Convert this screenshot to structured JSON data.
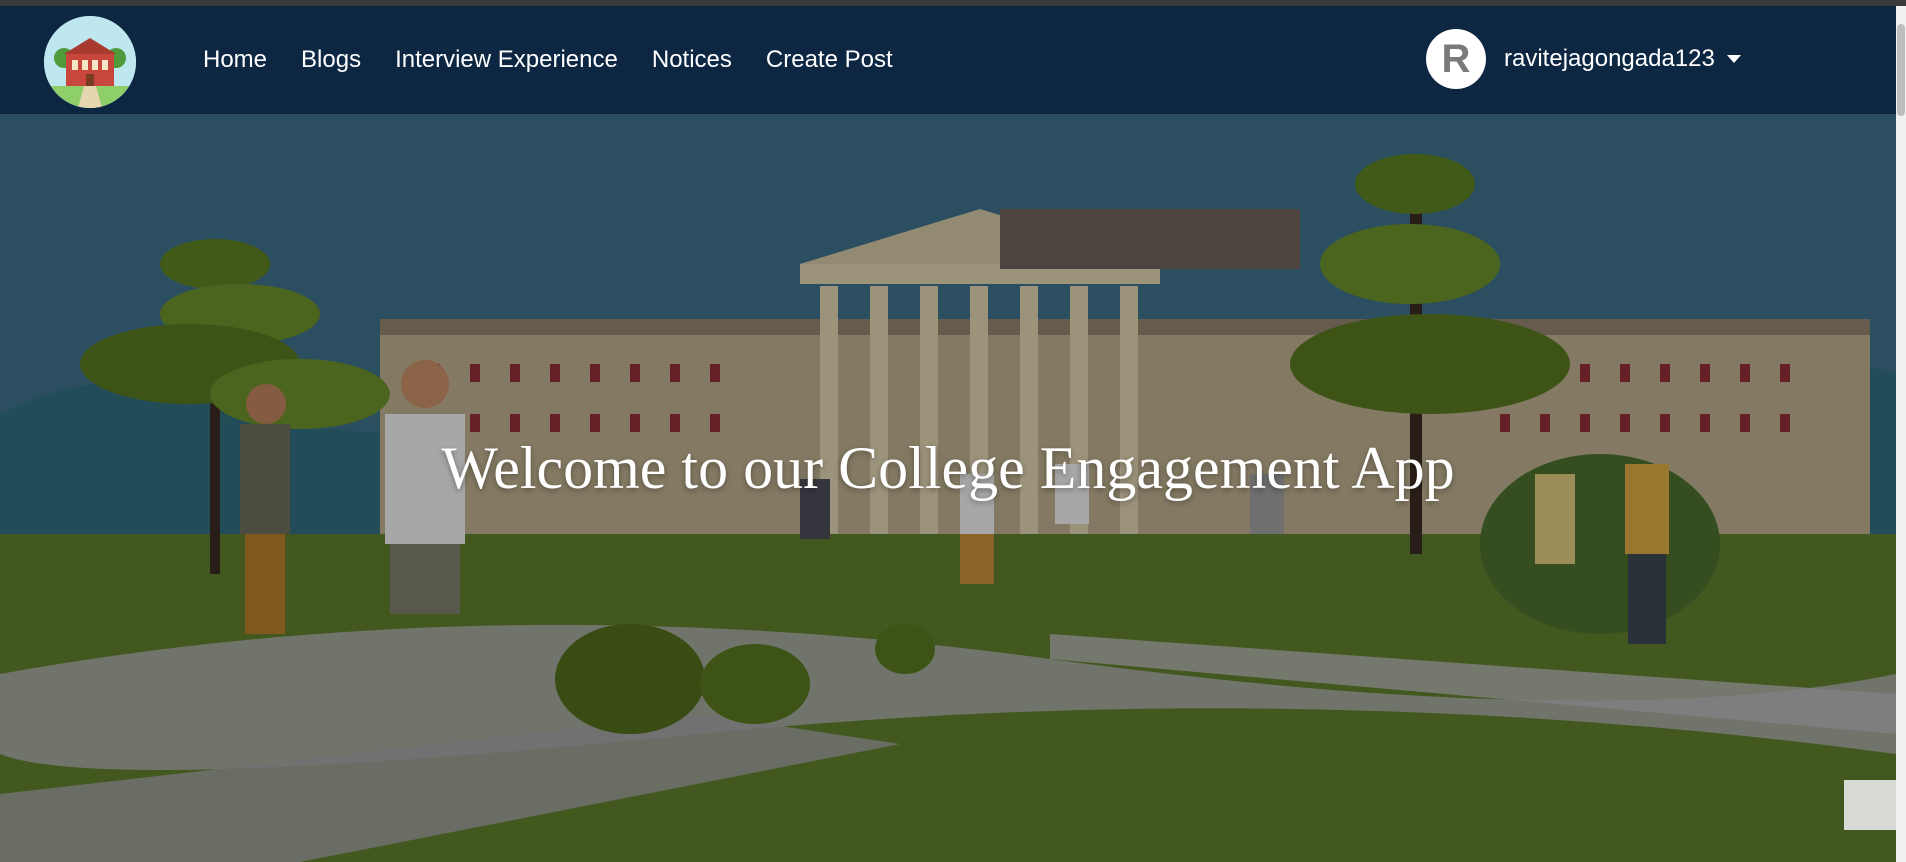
{
  "navbar": {
    "logo_icon": "university-building-icon",
    "links": [
      "Home",
      "Blogs",
      "Interview Experience",
      "Notices",
      "Create Post"
    ],
    "user": {
      "avatar_letter": "R",
      "username": "ravitejagongada123"
    }
  },
  "hero": {
    "title": "Welcome to our College Engagement App",
    "image": "campus-illustration-with-students"
  },
  "colors": {
    "navbar_bg": "#0d2642",
    "text": "#ffffff"
  }
}
